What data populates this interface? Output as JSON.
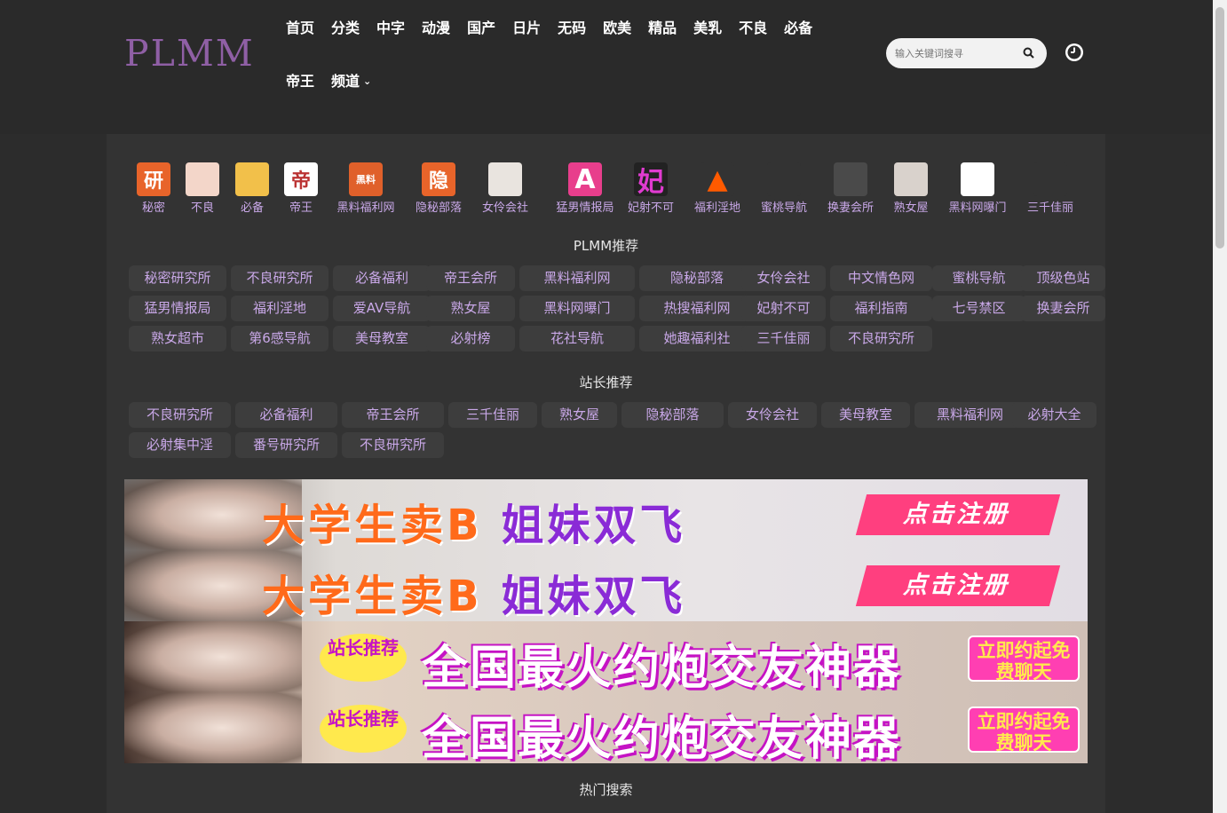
{
  "header": {
    "logo": "PLMM",
    "nav_row1": [
      "首页",
      "分类",
      "中字",
      "动漫",
      "国产",
      "日片",
      "无码",
      "欧美",
      "精品",
      "美乳",
      "不良",
      "必备"
    ],
    "nav_row2": [
      "帝王",
      "频道"
    ],
    "search_placeholder": "输入关键词搜寻"
  },
  "sites": [
    {
      "label": "秘密",
      "glyph": "研",
      "color": "#e8642a"
    },
    {
      "label": "不良",
      "glyph": "",
      "color": "#f3d6c9"
    },
    {
      "label": "必备",
      "glyph": "",
      "color": "#f2c04a"
    },
    {
      "label": "帝王",
      "glyph": "帝",
      "color": "#ffffff"
    },
    {
      "label": "黑料福利网",
      "glyph": "黑料",
      "color": "#e0602a"
    },
    {
      "label": "隐秘部落",
      "glyph": "隐",
      "color": "#e8642a"
    },
    {
      "label": "女伶会社",
      "glyph": "",
      "color": "#e9e4df"
    },
    {
      "label": "猛男情报局",
      "glyph": "A",
      "color": "#e83e8c"
    },
    {
      "label": "妃射不可",
      "glyph": "妃",
      "color": "#222222"
    },
    {
      "label": "福利淫地",
      "glyph": "▲",
      "color": "#333333"
    },
    {
      "label": "蜜桃导航",
      "glyph": "",
      "color": "#333333"
    },
    {
      "label": "换妻会所",
      "glyph": "",
      "color": "#4a4a4a"
    },
    {
      "label": "熟女屋",
      "glyph": "",
      "color": "#d9d2cc"
    },
    {
      "label": "黑料网曝门",
      "glyph": "",
      "color": "#ffffff"
    },
    {
      "label": "三千佳丽",
      "glyph": "",
      "color": "#333333"
    }
  ],
  "plmm_title": "PLMM推荐",
  "plmm_tags": [
    "秘密研究所",
    "不良研究所",
    "必备福利",
    "帝王会所",
    "黑料福利网",
    "隐秘部落",
    "女伶会社",
    "中文情色网",
    "蜜桃导航",
    "顶级色站",
    "猛男情报局",
    "福利淫地",
    "爱AV导航",
    "熟女屋",
    "黑料网曝门",
    "热搜福利网",
    "妃射不可",
    "福利指南",
    "七号禁区",
    "换妻会所",
    "熟女超市",
    "第6感导航",
    "美母教室",
    "必射榜",
    "花社导航",
    "她趣福利社",
    "三千佳丽",
    "不良研究所"
  ],
  "owner_title": "站长推荐",
  "owner_tags": [
    "不良研究所",
    "必备福利",
    "帝王会所",
    "三千佳丽",
    "熟女屋",
    "隐秘部落",
    "女伶会社",
    "美母教室",
    "黑料福利网",
    "必射大全",
    "必射集中淫",
    "番号研究所",
    "不良研究所"
  ],
  "banners": [
    {
      "text_orange": "大学生卖B",
      "text_purple": "姐妹双飞",
      "cta": "点击注册"
    },
    {
      "text_orange": "大学生卖B",
      "text_purple": "姐妹双飞",
      "cta": "点击注册"
    },
    {
      "badge": "站长推荐",
      "text": "全国最火约炮交友神器",
      "cta": "立即约起免费聊天"
    },
    {
      "badge": "站长推荐",
      "text": "全国最火约炮交友神器",
      "cta": "立即约起免费聊天"
    }
  ],
  "hot_title": "热门搜索"
}
